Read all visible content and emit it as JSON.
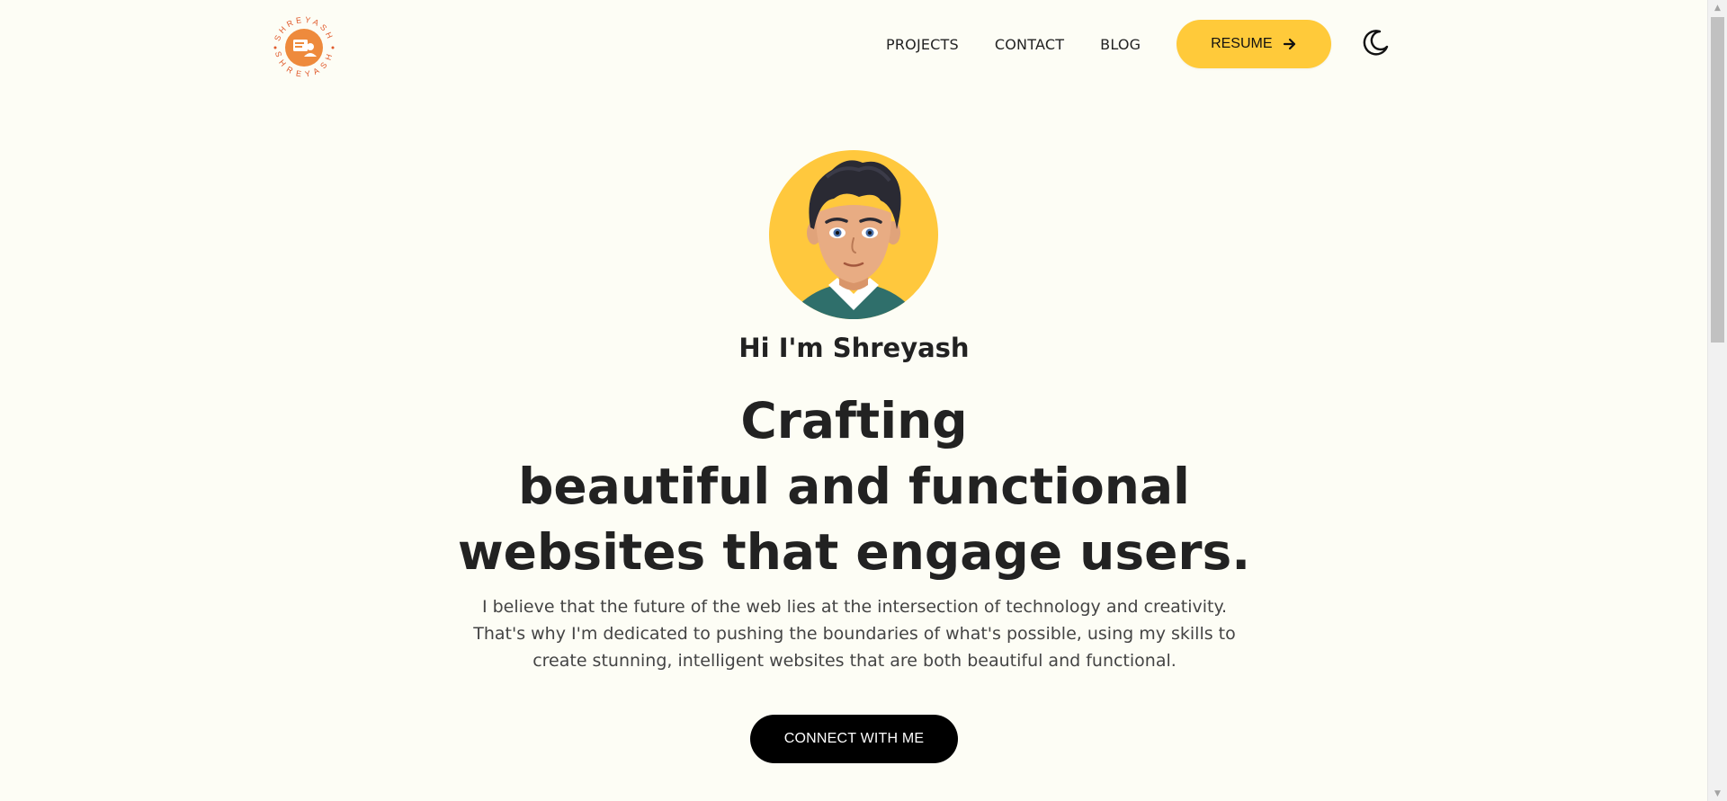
{
  "header": {
    "logo_text": "SHREYASH",
    "nav": [
      {
        "label": "PROJECTS"
      },
      {
        "label": "CONTACT"
      },
      {
        "label": "BLOG"
      }
    ],
    "resume_label": "RESUME",
    "resume_icon": "arrow-right-icon",
    "theme_icon": "moon-icon"
  },
  "hero": {
    "greeting": "Hi I'm Shreyash",
    "headline": [
      "Crafting",
      "beautiful and functional",
      "websites that engage users."
    ],
    "description": "I believe that the future of the web lies at the intersection of technology and creativity. That's why I'm dedicated to pushing the boundaries of what's possible, using my skills to create stunning, intelligent websites that are both beautiful and functional.",
    "cta_label": "CONNECT WITH ME"
  },
  "colors": {
    "background": "#fdfdf5",
    "accent": "#ffca3a",
    "logo": "#e8743b",
    "text": "#222222",
    "cta_background": "#000000"
  }
}
